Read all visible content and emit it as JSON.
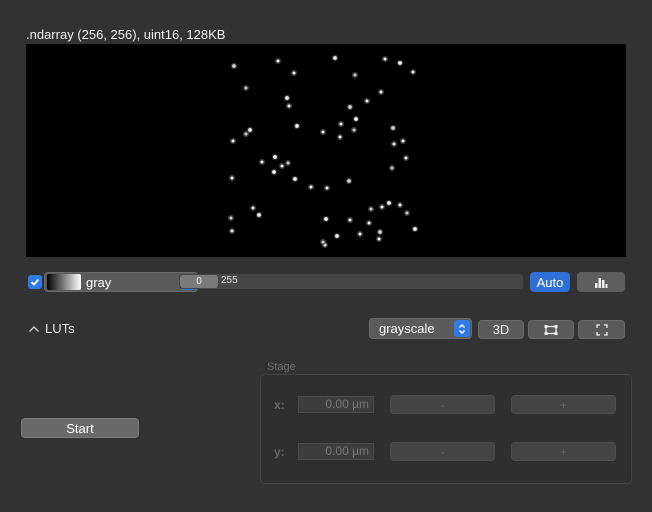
{
  "viewer": {
    "info": ".ndarray (256, 256), uint16, 128KB",
    "image_background": "#000000"
  },
  "lut": {
    "visible_checked": true,
    "colormap": "gray",
    "clim_min": "0",
    "clim_max": "255",
    "auto_label": "Auto",
    "accent_color": "#2f7ae5"
  },
  "luts_section": {
    "label": "LUTs",
    "expanded": false
  },
  "toolbar": {
    "mode_value": "grayscale",
    "btn_3d": "3D"
  },
  "start_button": "Start",
  "stage": {
    "title": "Stage",
    "x_label": "x:",
    "x_value": "0.00 µm",
    "y_label": "y:",
    "y_value": "0.00 µm",
    "minus": "-",
    "plus": "+"
  }
}
